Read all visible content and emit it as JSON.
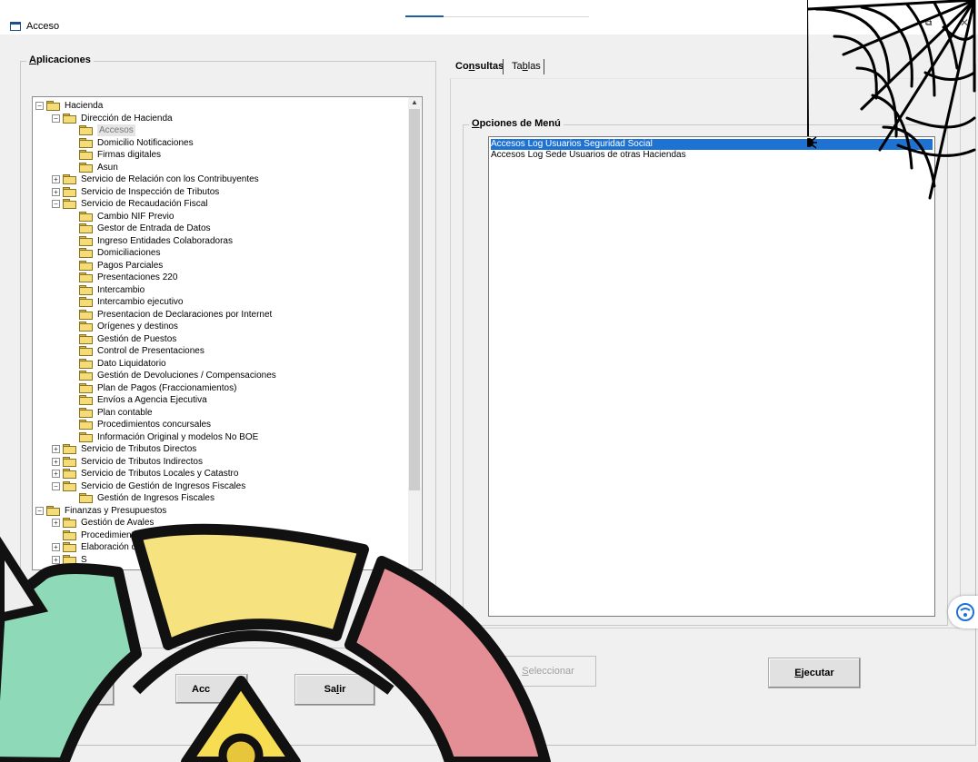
{
  "window": {
    "title": "Acceso"
  },
  "left_panel": {
    "label_prefix": "",
    "label_accel": "A",
    "label_rest": "plicaciones"
  },
  "tree": [
    {
      "label": "Hacienda",
      "level": 0,
      "expander": "−",
      "selected": false
    },
    {
      "label": "Dirección de Hacienda",
      "level": 1,
      "expander": "−",
      "selected": false
    },
    {
      "label": "Accesos",
      "level": 2,
      "expander": "",
      "selected": true
    },
    {
      "label": "Domicilio Notificaciones",
      "level": 2,
      "expander": "",
      "selected": false
    },
    {
      "label": "Firmas digitales",
      "level": 2,
      "expander": "",
      "selected": false
    },
    {
      "label": "Asun",
      "level": 2,
      "expander": "",
      "selected": false
    },
    {
      "label": "Servicio de Relación con los Contribuyentes",
      "level": 1,
      "expander": "+",
      "selected": false
    },
    {
      "label": "Servicio de Inspección de Tributos",
      "level": 1,
      "expander": "+",
      "selected": false
    },
    {
      "label": "Servicio de Recaudación Fiscal",
      "level": 1,
      "expander": "−",
      "selected": false
    },
    {
      "label": "Cambio NIF Previo",
      "level": 2,
      "expander": "",
      "selected": false
    },
    {
      "label": "Gestor de Entrada de Datos",
      "level": 2,
      "expander": "",
      "selected": false
    },
    {
      "label": "Ingreso Entidades Colaboradoras",
      "level": 2,
      "expander": "",
      "selected": false
    },
    {
      "label": "Domiciliaciones",
      "level": 2,
      "expander": "",
      "selected": false
    },
    {
      "label": "Pagos Parciales",
      "level": 2,
      "expander": "",
      "selected": false
    },
    {
      "label": "Presentaciones 220",
      "level": 2,
      "expander": "",
      "selected": false
    },
    {
      "label": "Intercambio",
      "level": 2,
      "expander": "",
      "selected": false
    },
    {
      "label": "Intercambio ejecutivo",
      "level": 2,
      "expander": "",
      "selected": false
    },
    {
      "label": "Presentacion de Declaraciones por Internet",
      "level": 2,
      "expander": "",
      "selected": false
    },
    {
      "label": "Orígenes y destinos",
      "level": 2,
      "expander": "",
      "selected": false
    },
    {
      "label": "Gestión de Puestos",
      "level": 2,
      "expander": "",
      "selected": false
    },
    {
      "label": "Control de Presentaciones",
      "level": 2,
      "expander": "",
      "selected": false
    },
    {
      "label": "Dato Liquidatorio",
      "level": 2,
      "expander": "",
      "selected": false
    },
    {
      "label": "Gestión de Devoluciones / Compensaciones",
      "level": 2,
      "expander": "",
      "selected": false
    },
    {
      "label": "Plan de Pagos (Fraccionamientos)",
      "level": 2,
      "expander": "",
      "selected": false
    },
    {
      "label": "Envíos a Agencia Ejecutiva",
      "level": 2,
      "expander": "",
      "selected": false
    },
    {
      "label": "Plan contable",
      "level": 2,
      "expander": "",
      "selected": false
    },
    {
      "label": "Procedimientos concursales",
      "level": 2,
      "expander": "",
      "selected": false
    },
    {
      "label": "Información Original y modelos No BOE",
      "level": 2,
      "expander": "",
      "selected": false
    },
    {
      "label": "Servicio de Tributos Directos",
      "level": 1,
      "expander": "+",
      "selected": false
    },
    {
      "label": "Servicio de Tributos Indirectos",
      "level": 1,
      "expander": "+",
      "selected": false
    },
    {
      "label": "Servicio de Tributos Locales y Catastro",
      "level": 1,
      "expander": "+",
      "selected": false
    },
    {
      "label": "Servicio de Gestión de Ingresos Fiscales",
      "level": 1,
      "expander": "−",
      "selected": false
    },
    {
      "label": "Gestión de Ingresos Fiscales",
      "level": 2,
      "expander": "",
      "selected": false
    },
    {
      "label": "Finanzas y Presupuestos",
      "level": 0,
      "expander": "−",
      "selected": false
    },
    {
      "label": "Gestión de Avales",
      "level": 1,
      "expander": "+",
      "selected": false
    },
    {
      "label": "Procedimientos Fis",
      "level": 1,
      "expander": "",
      "selected": false
    },
    {
      "label": "Elaboración del",
      "level": 1,
      "expander": "+",
      "selected": false
    },
    {
      "label": "S",
      "level": 1,
      "expander": "+",
      "selected": false
    }
  ],
  "tabs": {
    "consultas_a": "Co",
    "consultas_u": "n",
    "consultas_b": "sultas",
    "tablas_a": "Ta",
    "tablas_u": "b",
    "tablas_b": "las"
  },
  "menu_options": {
    "label_accel": "O",
    "label_rest": "pciones de Menú",
    "items": [
      {
        "label": "Accesos Log Usuarios Seguridad Social",
        "selected": true
      },
      {
        "label": "Accesos Log Sede Usuarios de otras Haciendas",
        "selected": false
      }
    ]
  },
  "buttons": {
    "seleccionar_accel": "S",
    "seleccionar_rest": "eleccionar",
    "ejecutar_accel": "E",
    "ejecutar_rest": "jecutar",
    "aceptar_visible": "Acc",
    "salir_a": "Sa",
    "salir_u": "l",
    "salir_b": "ir"
  },
  "overlay_colors": {
    "ring_green": "#8ed9b8",
    "ring_yellow": "#f6e27f",
    "ring_red": "#e48f95",
    "triangle_yellow": "#f7dd52",
    "selection_blue": "#1e73d2"
  }
}
